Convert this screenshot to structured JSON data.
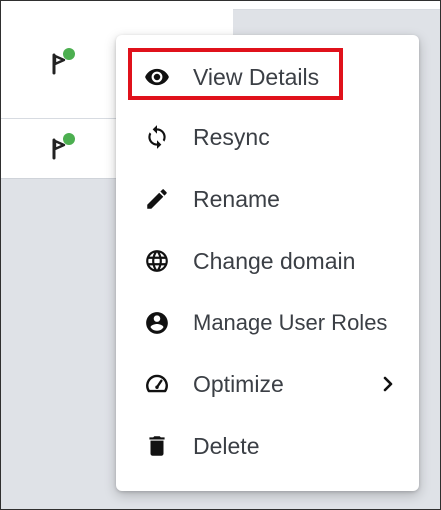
{
  "menu": {
    "items": [
      {
        "label": "View Details",
        "icon": "eye-icon"
      },
      {
        "label": "Resync",
        "icon": "sync-icon"
      },
      {
        "label": "Rename",
        "icon": "pencil-icon"
      },
      {
        "label": "Change domain",
        "icon": "globe-icon"
      },
      {
        "label": "Manage User Roles",
        "icon": "account-circle-icon"
      },
      {
        "label": "Optimize",
        "icon": "speedometer-icon",
        "submenu_icon": "chevron-right-icon"
      },
      {
        "label": "Delete",
        "icon": "trash-icon"
      }
    ],
    "highlighted_item": "View Details"
  },
  "list": {
    "rows": [
      {
        "icon": "flag-icon",
        "status_color": "#4caf50"
      },
      {
        "icon": "flag-icon",
        "status_color": "#4caf50"
      }
    ]
  },
  "colors": {
    "highlight_border": "#e0111b",
    "status_dot": "#4caf50",
    "icon": "#111111",
    "text": "#3b3f45"
  }
}
